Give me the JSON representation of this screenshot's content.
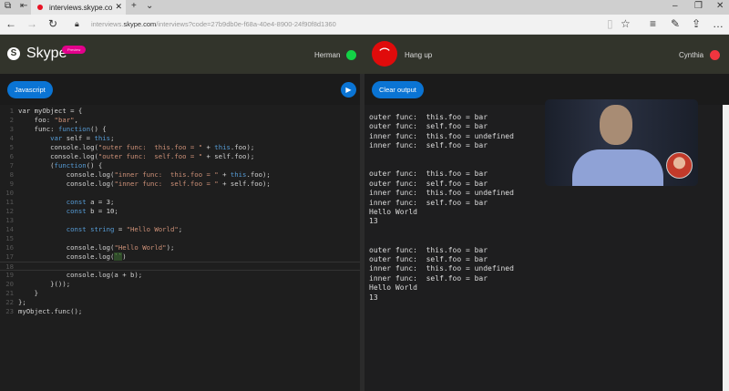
{
  "browser": {
    "tab_title": "interviews.skype.co",
    "url_host_prefix": "interviews.",
    "url_domain": "skype.com",
    "url_path": "/interviews?code=27b9db0e-f68a-40e4-8900-24f90f8d1360"
  },
  "header": {
    "brand": "Skype",
    "badge": "Preview",
    "participant_left": "Herman",
    "participant_right": "Cynthia",
    "hangup_label": "Hang up",
    "left_status_color": "#13d146",
    "right_status_color": "#f0353f"
  },
  "toolbar": {
    "language": "Javascript",
    "clear_label": "Clear output"
  },
  "code": [
    [
      [
        "tx",
        "var "
      ],
      [
        "tx",
        "myObject = {"
      ]
    ],
    [
      [
        "tx",
        "    foo: "
      ],
      [
        "str",
        "\"bar\""
      ],
      [
        "tx",
        ","
      ]
    ],
    [
      [
        "tx",
        "    func: "
      ],
      [
        "kw",
        "function"
      ],
      [
        "tx",
        "() {"
      ]
    ],
    [
      [
        "kw",
        "        var "
      ],
      [
        "tx",
        "self = "
      ],
      [
        "kw",
        "this"
      ],
      [
        "tx",
        ";"
      ]
    ],
    [
      [
        "tx",
        "        console.log("
      ],
      [
        "str",
        "\"outer func:  this.foo = \""
      ],
      [
        "tx",
        " + "
      ],
      [
        "kw",
        "this"
      ],
      [
        "tx",
        ".foo);"
      ]
    ],
    [
      [
        "tx",
        "        console.log("
      ],
      [
        "str",
        "\"outer func:  self.foo = \""
      ],
      [
        "tx",
        " + self.foo);"
      ]
    ],
    [
      [
        "tx",
        "        ("
      ],
      [
        "kw",
        "function"
      ],
      [
        "tx",
        "() {"
      ]
    ],
    [
      [
        "tx",
        "            console.log("
      ],
      [
        "str",
        "\"inner func:  this.foo = \""
      ],
      [
        "tx",
        " + "
      ],
      [
        "kw",
        "this"
      ],
      [
        "tx",
        ".foo);"
      ]
    ],
    [
      [
        "tx",
        "            console.log("
      ],
      [
        "str",
        "\"inner func:  self.foo = \""
      ],
      [
        "tx",
        " + self.foo);"
      ]
    ],
    [],
    [
      [
        "kw",
        "            const "
      ],
      [
        "tx",
        "a = 3;"
      ]
    ],
    [
      [
        "kw",
        "            const "
      ],
      [
        "tx",
        "b = 10;"
      ]
    ],
    [],
    [
      [
        "kw",
        "            const string "
      ],
      [
        "tx",
        "= "
      ],
      [
        "str",
        "\"Hello World\""
      ],
      [
        "tx",
        ";"
      ]
    ],
    [],
    [
      [
        "tx",
        "            console.log("
      ],
      [
        "str",
        "\"Hello World\""
      ],
      [
        "tx",
        ");"
      ]
    ],
    [
      [
        "tx",
        "            console.log("
      ],
      [
        "hl",
        "``"
      ],
      [
        "tx",
        ")"
      ]
    ],
    [],
    [
      [
        "tx",
        "            console.log(a + b);"
      ]
    ],
    [
      [
        "tx",
        "        }());"
      ]
    ],
    [
      [
        "tx",
        "    }"
      ]
    ],
    [
      [
        "tx",
        "};"
      ]
    ],
    [
      [
        "tx",
        "myObject.func();"
      ]
    ]
  ],
  "output": [
    "outer func:  this.foo = bar",
    "outer func:  self.foo = bar",
    "inner func:  this.foo = undefined",
    "inner func:  self.foo = bar",
    "",
    "",
    "outer func:  this.foo = bar",
    "outer func:  self.foo = bar",
    "inner func:  this.foo = undefined",
    "inner func:  self.foo = bar",
    "Hello World",
    "13",
    "",
    "",
    "outer func:  this.foo = bar",
    "outer func:  self.foo = bar",
    "inner func:  this.foo = undefined",
    "inner func:  self.foo = bar",
    "Hello World",
    "13"
  ]
}
